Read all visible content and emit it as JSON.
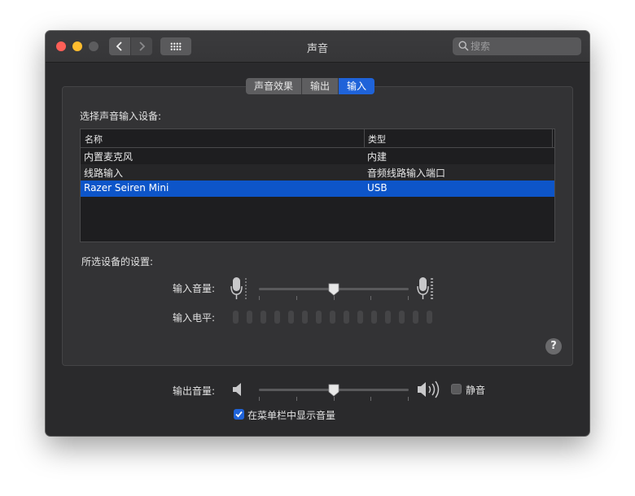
{
  "window": {
    "title": "声音"
  },
  "toolbar": {
    "back_icon": "chevron-left-icon",
    "forward_icon": "chevron-right-icon",
    "grid_icon": "show-all-grid-icon"
  },
  "search": {
    "placeholder": "搜索"
  },
  "tabs": [
    {
      "label": "声音效果",
      "active": false
    },
    {
      "label": "输出",
      "active": false
    },
    {
      "label": "输入",
      "active": true
    }
  ],
  "input_section": {
    "heading": "选择声音输入设备:",
    "columns": [
      "名称",
      "类型"
    ],
    "devices": [
      {
        "name": "内置麦克风",
        "type": "内建",
        "selected": false
      },
      {
        "name": "线路输入",
        "type": "音频线路输入端口",
        "selected": false
      },
      {
        "name": "Razer Seiren Mini",
        "type": "USB",
        "selected": true
      }
    ],
    "settings_heading": "所选设备的设置:",
    "input_volume_label": "输入音量:",
    "input_volume_fraction": 0.5,
    "input_level_label": "输入电平:",
    "input_level_segments": 15,
    "input_level_active": 0
  },
  "output": {
    "volume_label": "输出音量:",
    "volume_fraction": 0.5,
    "mute_label": "静音",
    "mute_checked": false,
    "show_in_menubar_label": "在菜单栏中显示音量",
    "show_in_menubar_checked": true
  },
  "colors": {
    "accent": "#1f63d9",
    "selection": "#0d55c9",
    "window_bg": "#2a2a2c"
  }
}
